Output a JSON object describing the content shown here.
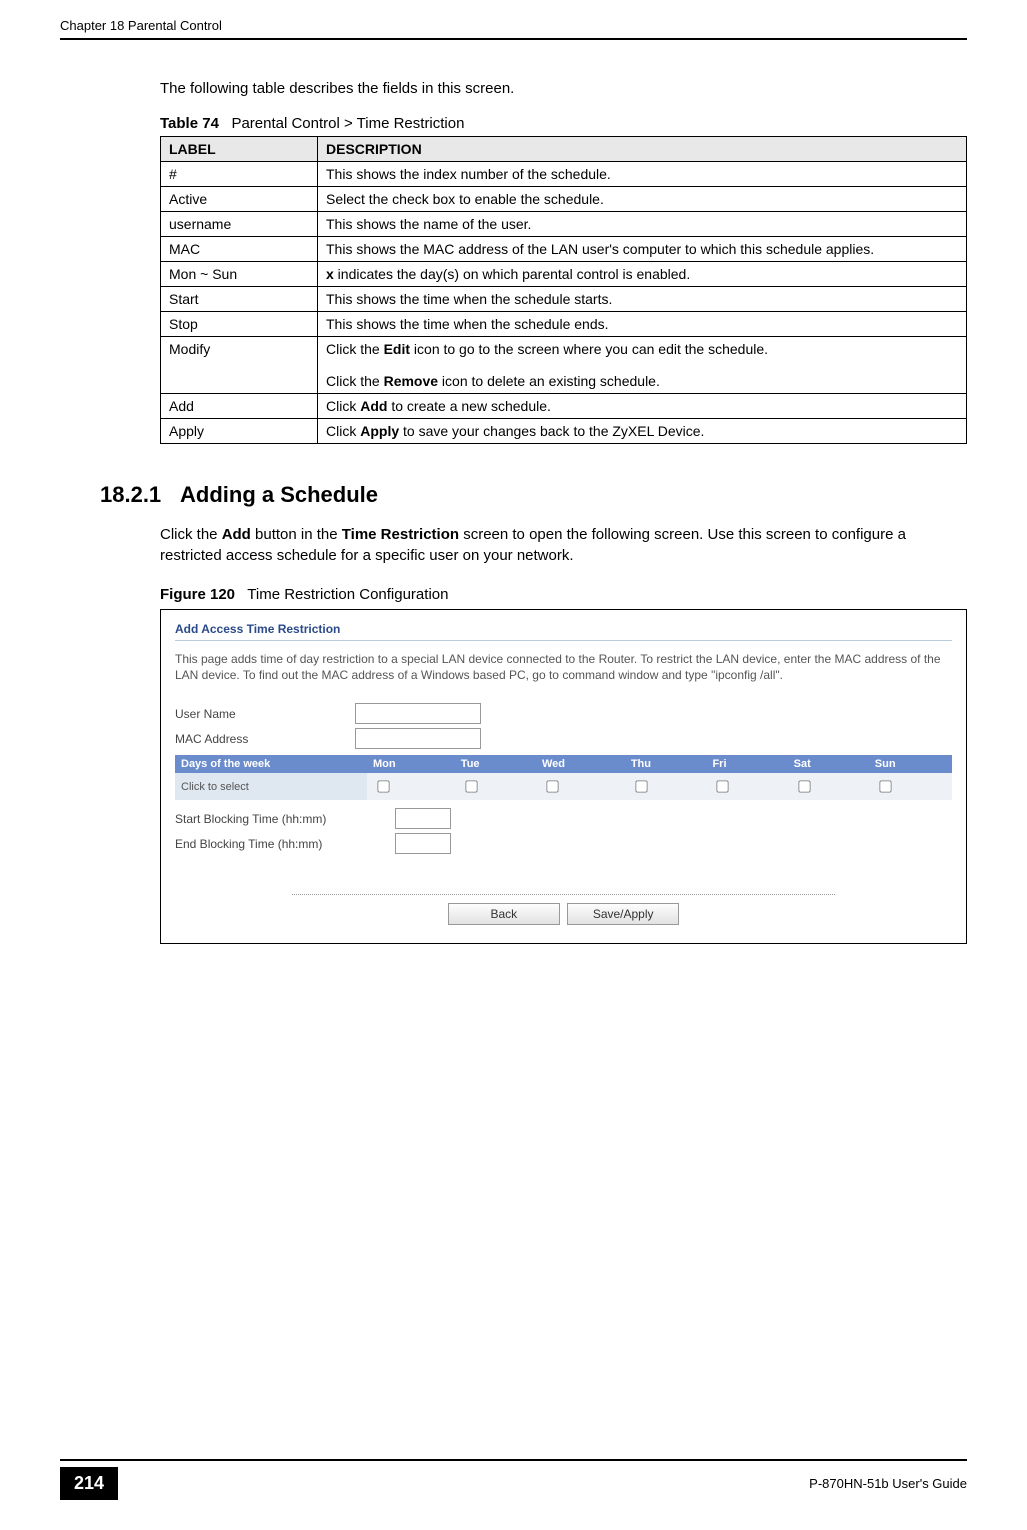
{
  "header": {
    "chapter": "Chapter 18 Parental Control"
  },
  "intro": "The following table describes the fields in this screen.",
  "table_caption": {
    "number": "Table 74",
    "title": "Parental Control > Time Restriction"
  },
  "table_headers": {
    "label": "LABEL",
    "description": "DESCRIPTION"
  },
  "table_rows": [
    {
      "label": "#",
      "desc_plain": "This shows the index number of the schedule."
    },
    {
      "label": "Active",
      "desc_plain": "Select the check box to enable the schedule."
    },
    {
      "label": "username",
      "desc_plain": "This shows the name of the user."
    },
    {
      "label": "MAC",
      "desc_plain": "This shows the MAC address of the LAN user's computer to which this schedule applies."
    },
    {
      "label": "Mon ~ Sun",
      "desc_pre_bold": "x",
      "desc_post": " indicates the day(s) on which parental control is enabled."
    },
    {
      "label": "Start",
      "desc_plain": "This shows the time when the schedule starts."
    },
    {
      "label": "Stop",
      "desc_plain": "This shows the time when the schedule ends."
    },
    {
      "label": "Modify",
      "desc_line1_pre": "Click the ",
      "desc_line1_bold": "Edit",
      "desc_line1_post": " icon to go to the screen where you can edit the schedule.",
      "desc_line2_pre": "Click the ",
      "desc_line2_bold": "Remove",
      "desc_line2_post": " icon to delete an existing schedule."
    },
    {
      "label": "Add",
      "desc_pre": "Click ",
      "desc_bold": "Add",
      "desc_post": " to create a new schedule."
    },
    {
      "label": "Apply",
      "desc_pre": "Click ",
      "desc_bold": "Apply",
      "desc_post": " to save your changes back to the ZyXEL Device."
    }
  ],
  "section": {
    "number": "18.2.1",
    "title": "Adding a Schedule",
    "body_pre": "Click the ",
    "body_bold1": "Add",
    "body_mid1": " button in the ",
    "body_bold2": "Time Restriction",
    "body_post": " screen to open the following screen. Use this screen to configure a restricted access schedule for a specific user on your network."
  },
  "figure_caption": {
    "number": "Figure 120",
    "title": "Time Restriction Configuration"
  },
  "figure": {
    "title": "Add Access Time Restriction",
    "description": "This page adds time of day restriction to a special LAN device connected to the Router. To restrict the LAN device, enter the MAC address of the LAN device. To find out the MAC address of a Windows based PC, go to command window and type \"ipconfig /all\".",
    "user_name_label": "User Name",
    "mac_label": "MAC Address",
    "dow_header": "Days of the week",
    "days": [
      "Mon",
      "Tue",
      "Wed",
      "Thu",
      "Fri",
      "Sat",
      "Sun"
    ],
    "click_to_select": "Click to select",
    "start_label": "Start Blocking Time (hh:mm)",
    "end_label": "End Blocking Time (hh:mm)",
    "back_btn": "Back",
    "save_btn": "Save/Apply"
  },
  "footer": {
    "page_number": "214",
    "guide": "P-870HN-51b User's Guide"
  }
}
